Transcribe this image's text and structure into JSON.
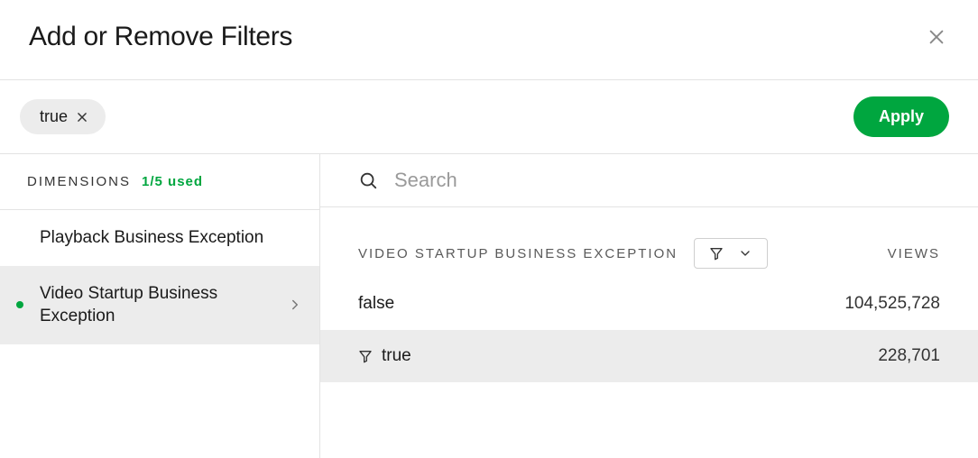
{
  "header": {
    "title": "Add or Remove Filters"
  },
  "filter_bar": {
    "chips": [
      {
        "label": "true"
      }
    ],
    "apply_label": "Apply"
  },
  "sidebar": {
    "heading": "DIMENSIONS",
    "used_label": "1/5 used",
    "items": [
      {
        "label": "Playback Business Exception",
        "active": false,
        "has_dot": false
      },
      {
        "label": "Video Startup Business Exception",
        "active": true,
        "has_dot": true
      }
    ]
  },
  "search": {
    "placeholder": "Search",
    "value": ""
  },
  "values": {
    "heading": "VIDEO STARTUP BUSINESS EXCEPTION",
    "views_label": "VIEWS",
    "rows": [
      {
        "value": "false",
        "views": "104,525,728",
        "selected": false
      },
      {
        "value": "true",
        "views": "228,701",
        "selected": true
      }
    ]
  }
}
